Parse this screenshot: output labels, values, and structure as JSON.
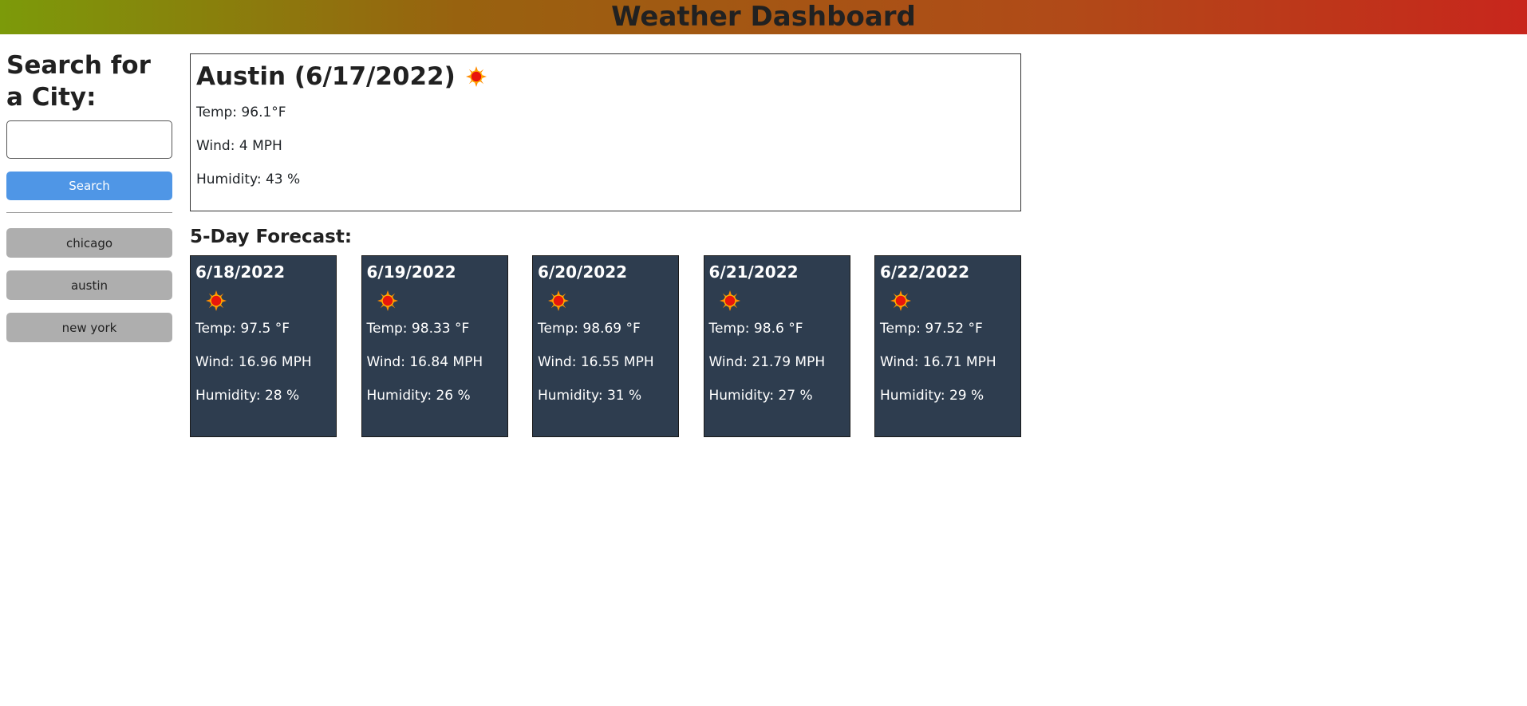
{
  "header": {
    "title": "Weather Dashboard"
  },
  "search": {
    "heading": "Search for a City:",
    "input_value": "",
    "button_label": "Search"
  },
  "history": [
    "chicago",
    "austin",
    "new york"
  ],
  "current": {
    "title": "Austin (6/17/2022)",
    "icon": "sun-icon",
    "temp": "Temp: 96.1°F",
    "wind": "Wind: 4 MPH",
    "humidity": "Humidity: 43 %"
  },
  "forecast": {
    "title": "5-Day Forecast:",
    "days": [
      {
        "date": "6/18/2022",
        "icon": "sun-icon",
        "temp": "Temp: 97.5 °F",
        "wind": "Wind: 16.96 MPH",
        "humidity": "Humidity: 28 %"
      },
      {
        "date": "6/19/2022",
        "icon": "sun-icon",
        "temp": "Temp: 98.33 °F",
        "wind": "Wind: 16.84 MPH",
        "humidity": "Humidity: 26 %"
      },
      {
        "date": "6/20/2022",
        "icon": "sun-icon",
        "temp": "Temp: 98.69 °F",
        "wind": "Wind: 16.55 MPH",
        "humidity": "Humidity: 31 %"
      },
      {
        "date": "6/21/2022",
        "icon": "sun-icon",
        "temp": "Temp: 98.6 °F",
        "wind": "Wind: 21.79 MPH",
        "humidity": "Humidity: 27 %"
      },
      {
        "date": "6/22/2022",
        "icon": "sun-icon",
        "temp": "Temp: 97.52 °F",
        "wind": "Wind: 16.71 MPH",
        "humidity": "Humidity: 29 %"
      }
    ]
  },
  "colors": {
    "header_gradient_start": "#7c9a0a",
    "header_gradient_end": "#c8261c",
    "search_button": "#4f96e6",
    "history_button": "#aeaeae",
    "forecast_card": "#2e3d4f"
  }
}
